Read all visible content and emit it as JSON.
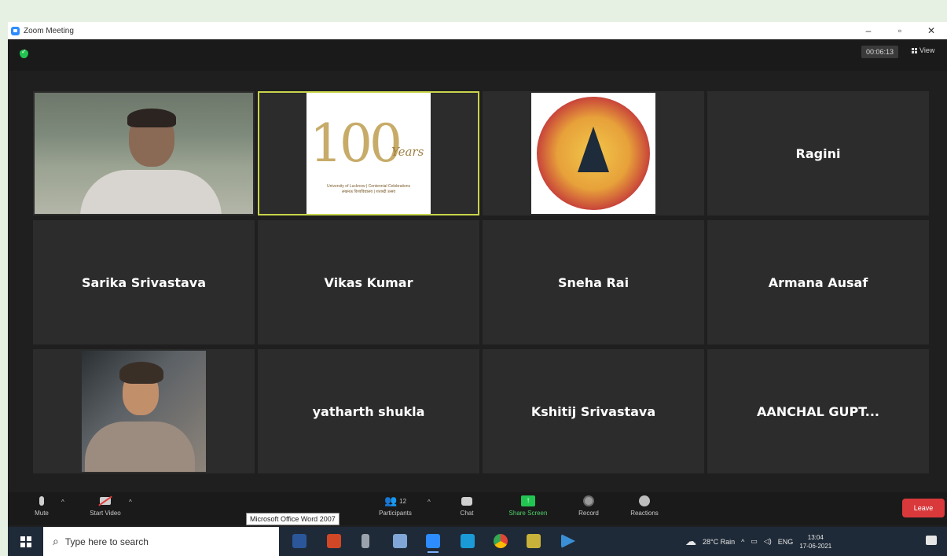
{
  "window": {
    "title": "Zoom Meeting",
    "controls": {
      "minimize": "–",
      "restore": "▫",
      "close": "✕"
    }
  },
  "meeting": {
    "timer": "00:06:13",
    "view_label": "View"
  },
  "tiles": [
    {
      "type": "video",
      "name": ""
    },
    {
      "type": "logo",
      "name": "",
      "logo_text": {
        "num": "100",
        "years": "Years",
        "line1": "University of Lucknow | Centennial Celebrations",
        "line2": "लखनऊ विश्वविद्यालय | शताब्दी उत्सव"
      }
    },
    {
      "type": "emblem",
      "name": ""
    },
    {
      "type": "name",
      "name": "Ragini"
    },
    {
      "type": "name",
      "name": "Sarika Srivastava"
    },
    {
      "type": "name",
      "name": "Vikas Kumar"
    },
    {
      "type": "name",
      "name": "Sneha Rai"
    },
    {
      "type": "name",
      "name": "Armana Ausaf"
    },
    {
      "type": "video",
      "name": ""
    },
    {
      "type": "name",
      "name": "yatharth shukla"
    },
    {
      "type": "name",
      "name": "Kshitij Srivastava"
    },
    {
      "type": "name",
      "name": "AANCHAL GUPT..."
    }
  ],
  "controls": {
    "mute": "Mute",
    "start_video": "Start Video",
    "participants": "Participants",
    "participant_count": "12",
    "chat": "Chat",
    "share_screen": "Share Screen",
    "record": "Record",
    "reactions": "Reactions",
    "leave": "Leave",
    "tooltip": "Microsoft Office Word 2007"
  },
  "taskbar": {
    "search_placeholder": "Type here to search",
    "weather": "28°C  Rain",
    "language": "ENG",
    "time": "13:04",
    "date": "17-06-2021",
    "apps": [
      "word-icon",
      "powerpoint-icon",
      "usb-icon",
      "display-icon",
      "zoom-icon",
      "store-icon",
      "chrome-icon",
      "app-icon",
      "arrow-app-icon"
    ]
  },
  "colors": {
    "accent_green": "#23c552",
    "leave_red": "#d9393b",
    "active_border": "#c9d44a",
    "zoom_blue": "#2d8cff"
  }
}
